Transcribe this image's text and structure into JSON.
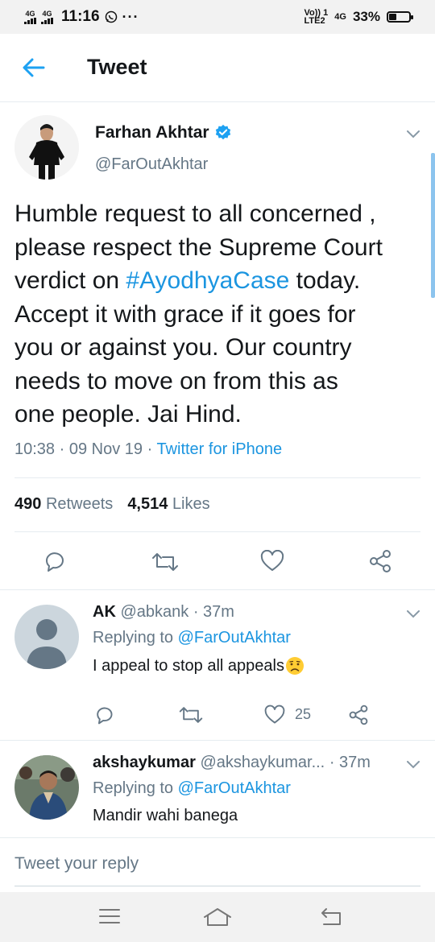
{
  "status_bar": {
    "network_1": "4G",
    "network_2": "4G",
    "time": "11:16",
    "volte_top": "Vo)) 1",
    "volte_bottom": "LTE2",
    "network_3": "4G",
    "battery": "33%"
  },
  "header": {
    "title": "Tweet"
  },
  "main_tweet": {
    "author_name": "Farhan Akhtar",
    "handle": "@FarOutAkhtar",
    "text_line_1": "Humble request to all concerned ,",
    "text_line_2": "please respect the Supreme Court",
    "text_line_3_pre": "verdict on ",
    "hashtag": "#AyodhyaCase",
    "text_line_3_post": " today.",
    "text_line_4": "Accept it with grace if it goes for",
    "text_line_5": "you or against you. Our country",
    "text_line_6": "needs to move on from this as",
    "text_line_7": "one people. Jai Hind.",
    "time": "10:38",
    "date": "09 Nov 19",
    "source": "Twitter for iPhone",
    "retweets_count": "490",
    "retweets_label": "Retweets",
    "likes_count": "4,514",
    "likes_label": "Likes"
  },
  "replies": [
    {
      "name": "AK",
      "handle": "@abkank",
      "time": "37m",
      "replying_label": "Replying to",
      "replying_to": "@FarOutAkhtar",
      "text": "I appeal to stop all appeals",
      "emoji": "frowning-face-emoji",
      "likes": "25"
    },
    {
      "name": "akshaykumar",
      "handle": "@akshaykumar...",
      "time": "37m",
      "replying_label": "Replying to",
      "replying_to": "@FarOutAkhtar",
      "text": "Mandir wahi banega"
    }
  ],
  "compose": {
    "placeholder": "Tweet your reply"
  },
  "colors": {
    "accent": "#1b95e0",
    "back_arrow": "#1da1f2",
    "secondary_text": "#657786",
    "divider": "#e6ecf0",
    "primary_text": "#14171a"
  },
  "icons": {
    "back": "arrow-left-icon",
    "verified": "verified-badge-icon",
    "caret": "chevron-down-icon",
    "reply": "reply-icon",
    "retweet": "retweet-icon",
    "like": "heart-icon",
    "share": "share-icon",
    "nav_menu": "menu-icon",
    "nav_home": "home-icon",
    "nav_back": "back-icon"
  }
}
